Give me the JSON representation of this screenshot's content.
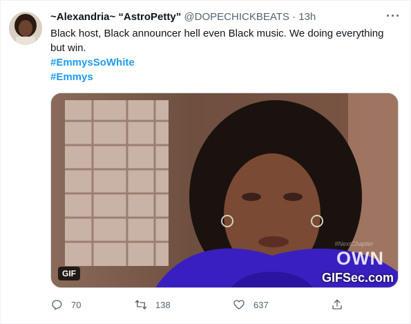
{
  "tweet": {
    "display_name": "~Alexandria~ “AstroPetty”",
    "handle": "@DOPECHICKBEATS",
    "separator": "·",
    "time": "13h",
    "more_icon": "more-horizontal-icon",
    "text": "Black host, Black announcer hell even Black music. We doing everything but win.",
    "hashtags": [
      "#EmmysSoWhite",
      "#Emmys"
    ],
    "accent_color": "#1d9bf0"
  },
  "media": {
    "badge": "GIF",
    "watermark_own": "OWN",
    "watermark_site": "GIFSec.com",
    "watermark_small": "#NextChapter"
  },
  "actions": {
    "reply": {
      "icon": "reply-icon",
      "count": "70"
    },
    "retweet": {
      "icon": "retweet-icon",
      "count": "138"
    },
    "like": {
      "icon": "heart-icon",
      "count": "637"
    },
    "share": {
      "icon": "share-icon"
    }
  }
}
